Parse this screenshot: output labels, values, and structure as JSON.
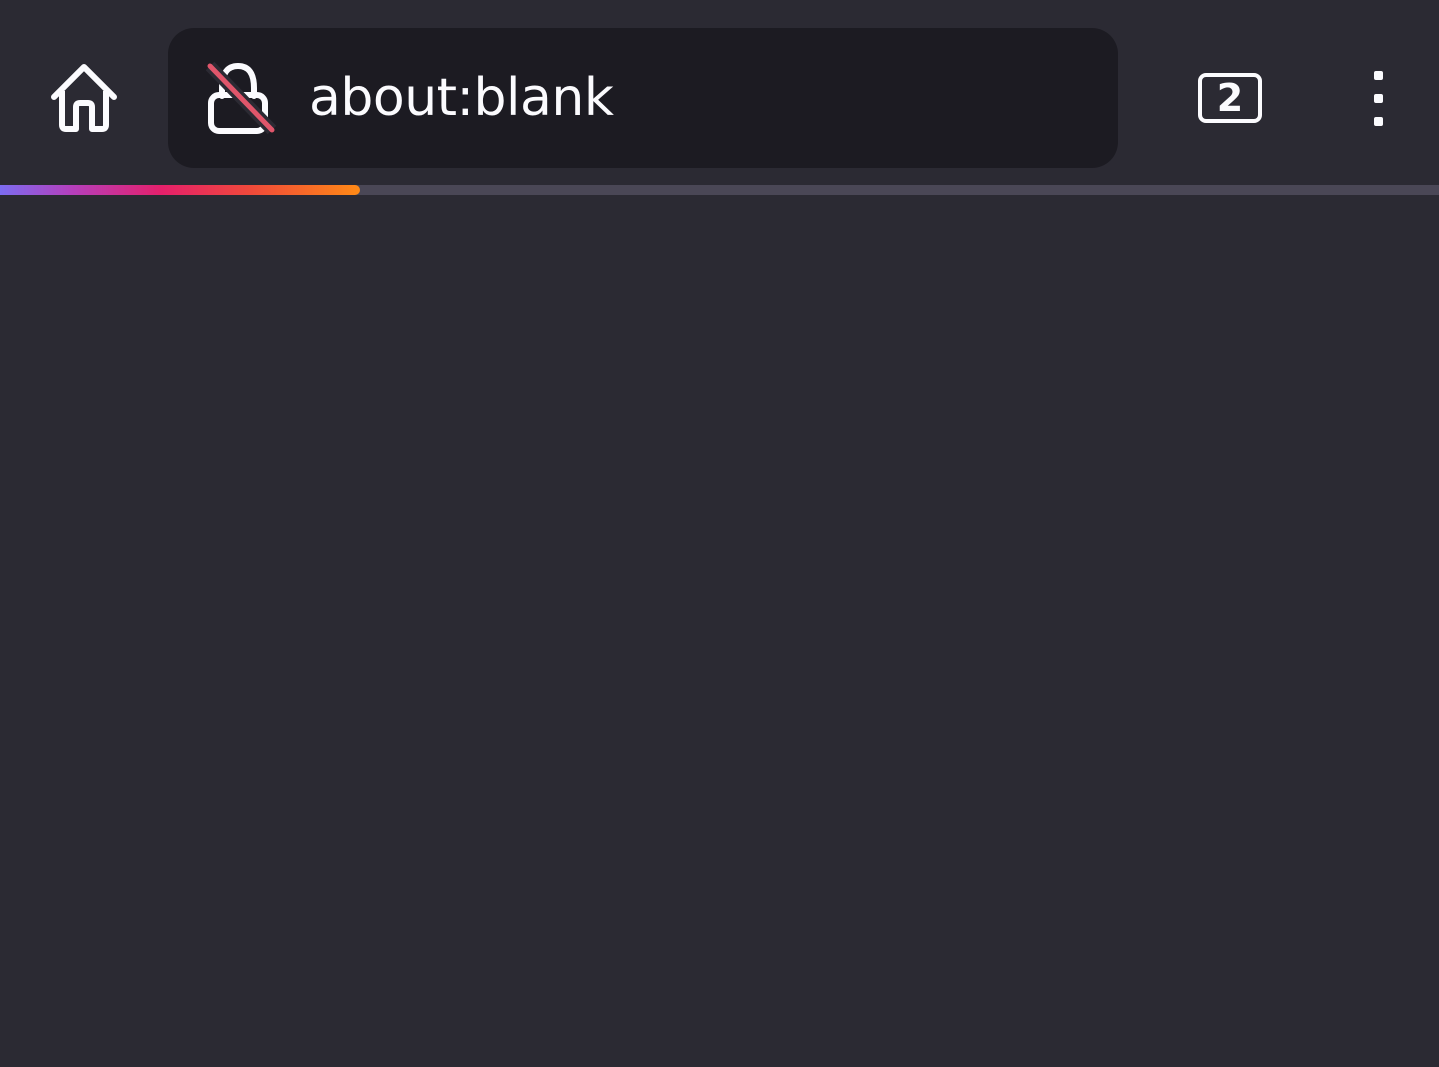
{
  "toolbar": {
    "home_icon": "home-icon",
    "lock_icon": "insecure-lock-icon",
    "url": "about:blank",
    "tab_count": "2",
    "menu_icon": "kebab-menu-icon"
  },
  "progress": {
    "fraction": 0.25
  },
  "colors": {
    "toolbar_bg": "#2b2a33",
    "urlbar_bg": "#1c1b22",
    "text": "#fbfbfe",
    "insecure_slash": "#e0566b",
    "progress_track": "#4a4756"
  }
}
